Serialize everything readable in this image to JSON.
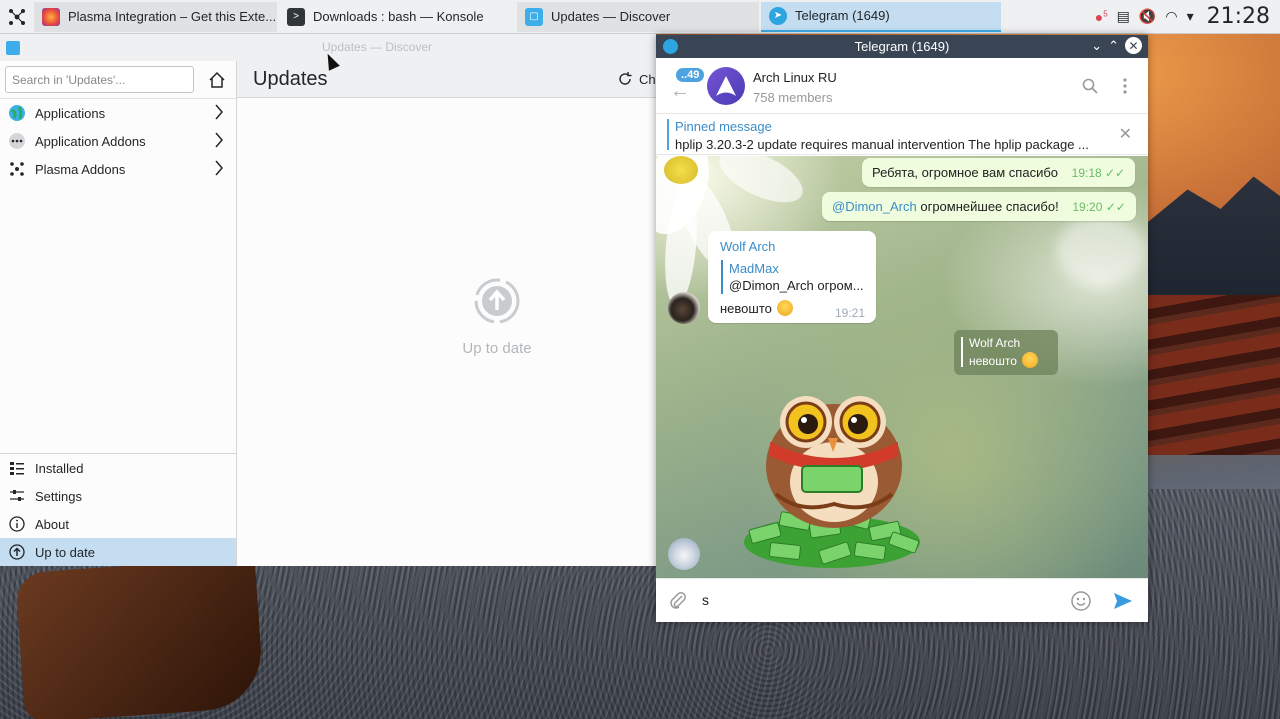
{
  "taskbar": {
    "tasks": [
      {
        "label": "Plasma Integration – Get this Exte...",
        "icon": "firefox-icon"
      },
      {
        "label": "Downloads : bash — Konsole",
        "icon": "konsole-icon"
      },
      {
        "label": "Updates — Discover",
        "icon": "discover-icon"
      },
      {
        "label": "Telegram (1649)",
        "icon": "telegram-icon",
        "badge": "1649"
      }
    ],
    "clock": "21:28",
    "tray_badge": "5"
  },
  "discover": {
    "window_title": "Updates — Discover",
    "search_placeholder": "Search in 'Updates'...",
    "categories": [
      {
        "label": "Applications"
      },
      {
        "label": "Application Addons"
      },
      {
        "label": "Plasma Addons"
      }
    ],
    "bottom_nav": [
      {
        "label": "Installed"
      },
      {
        "label": "Settings"
      },
      {
        "label": "About"
      },
      {
        "label": "Up to date"
      }
    ],
    "page_title": "Updates",
    "check_button": "Ch",
    "empty_state": "Up to date"
  },
  "telegram": {
    "window_title": "Telegram (1649)",
    "back_badge": "..49",
    "chat_name": "Arch Linux RU",
    "chat_members": "758 members",
    "pinned_title": "Pinned message",
    "pinned_text": "hplip 3.20.3-2 update requires manual intervention  The hplip package ...",
    "messages": [
      {
        "text": "Ребята, огромное вам спасибо",
        "time": "19:18"
      },
      {
        "mention": "@Dimon_Arch",
        "text": " огромнейшее спасибо!",
        "time": "19:20"
      }
    ],
    "incoming": {
      "author": "Wolf Arch",
      "reply_name": "MadMax",
      "reply_text": "@Dimon_Arch огром...",
      "text": "невошто",
      "time": "19:21"
    },
    "reply_chip": {
      "name": "Wolf Arch",
      "text": "невошто"
    },
    "compose_text": "s",
    "accent_color": "#3a8cc8",
    "outgoing_bubble_color": "#effdde"
  }
}
